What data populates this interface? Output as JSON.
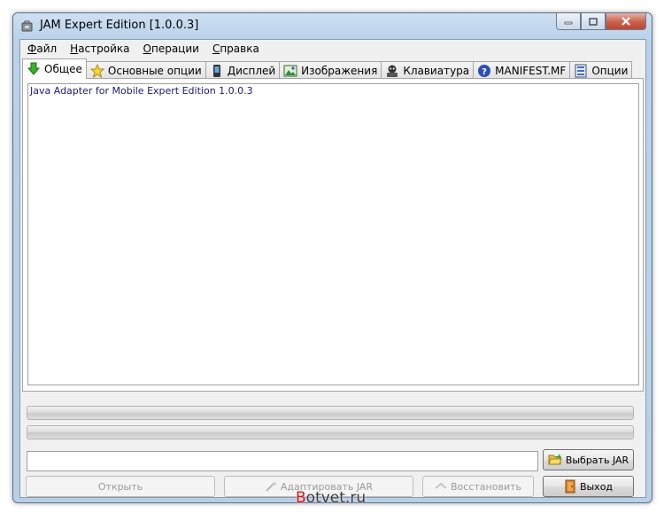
{
  "window": {
    "title": "JAM Expert Edition [1.0.0.3]"
  },
  "menu": [
    {
      "hotkey": "Ф",
      "rest": "айл"
    },
    {
      "hotkey": "Н",
      "rest": "астройка"
    },
    {
      "hotkey": "О",
      "rest": "перации"
    },
    {
      "hotkey": "С",
      "rest": "правка"
    }
  ],
  "tabs": [
    {
      "label": "Общее",
      "icon": "green-down-arrow-icon",
      "active": true
    },
    {
      "label": "Основные опции",
      "icon": "star-icon"
    },
    {
      "label": "Дисплей",
      "icon": "phone-icon"
    },
    {
      "label": "Изображения",
      "icon": "picture-icon"
    },
    {
      "label": "Клавиатура",
      "icon": "keyboard-icon"
    },
    {
      "label": "MANIFEST.MF",
      "icon": "help-icon"
    },
    {
      "label": "Опции",
      "icon": "options-icon"
    }
  ],
  "content": {
    "text": "Java Adapter for Mobile Expert Edition 1.0.0.3"
  },
  "path_input": {
    "value": ""
  },
  "buttons": {
    "choose_jar": "Выбрать JAR",
    "open": "Открыть",
    "adapt": "Адаптировать JAR",
    "restore": "Восстановить",
    "exit": "Выход"
  },
  "watermark": {
    "first": "B",
    "rest": "otvet.ru"
  },
  "colors": {
    "title_bar": "#b9d1ea",
    "close_button": "#c9604d",
    "content_text": "#1a1a7a"
  }
}
